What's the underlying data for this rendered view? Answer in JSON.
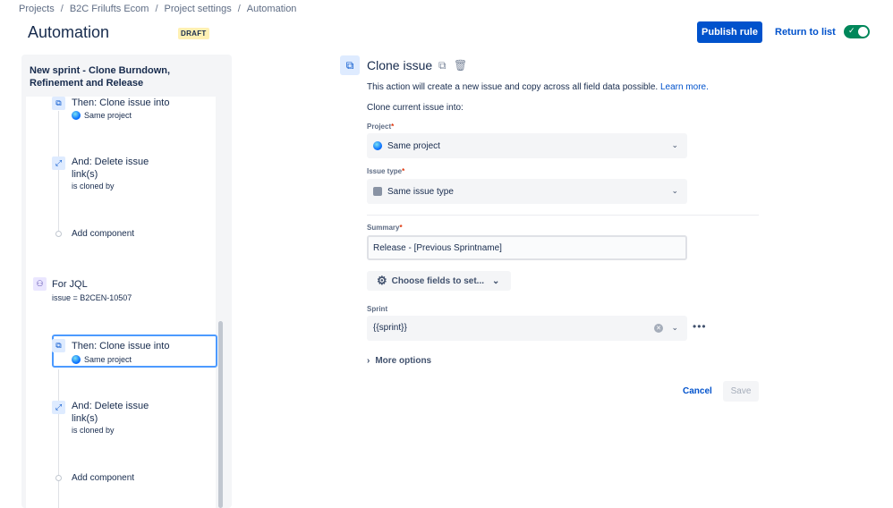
{
  "breadcrumb": [
    "Projects",
    "B2C Frilufts Ecom",
    "Project settings",
    "Automation"
  ],
  "breadcrumb_sep": "/",
  "page": {
    "title": "Automation",
    "badge": "DRAFT"
  },
  "header": {
    "publish": "Publish rule",
    "return": "Return to list",
    "toggle_on": true
  },
  "rule": {
    "title": "New sprint - Clone Burndown, Refinement and Release"
  },
  "flow": {
    "n1_title": "Then: Clone issue into",
    "n1_sub": "Same project",
    "n2_title": "And: Delete issue link(s)",
    "n2_sub": "is cloned by",
    "add1": "Add component",
    "jql_title": "For JQL",
    "jql_sub": "issue = B2CEN-10507",
    "n3_title": "Then: Clone issue into",
    "n3_sub": "Same project",
    "n4_title": "And: Delete issue link(s)",
    "n4_sub": "is cloned by",
    "add2": "Add component"
  },
  "form": {
    "title": "Clone issue",
    "description": "This action will create a new issue and copy across all field data possible.",
    "learn_more": "Learn more.",
    "clone_into": "Clone current issue into:",
    "project_label": "Project",
    "project_value": "Same project",
    "issue_type_label": "Issue type",
    "issue_type_value": "Same issue type",
    "summary_label": "Summary",
    "summary_value": "Release - [Previous Sprintname]",
    "choose_fields": "Choose fields to set...",
    "sprint_label": "Sprint",
    "sprint_value": "{{sprint}}",
    "more_options": "More options",
    "cancel": "Cancel",
    "save": "Save",
    "required_mark": "*"
  },
  "icons": [
    "clone-icon",
    "copy-icon",
    "trash-icon",
    "link-icon",
    "branch-icon",
    "globe-icon",
    "gear-icon",
    "chevron-down-icon",
    "clear-icon",
    "more-icon",
    "chevron-right-icon"
  ],
  "colors": {
    "primary": "#0052cc",
    "toggle": "#00875a",
    "draft": "#fff0b3",
    "selected_border": "#4c9aff"
  }
}
